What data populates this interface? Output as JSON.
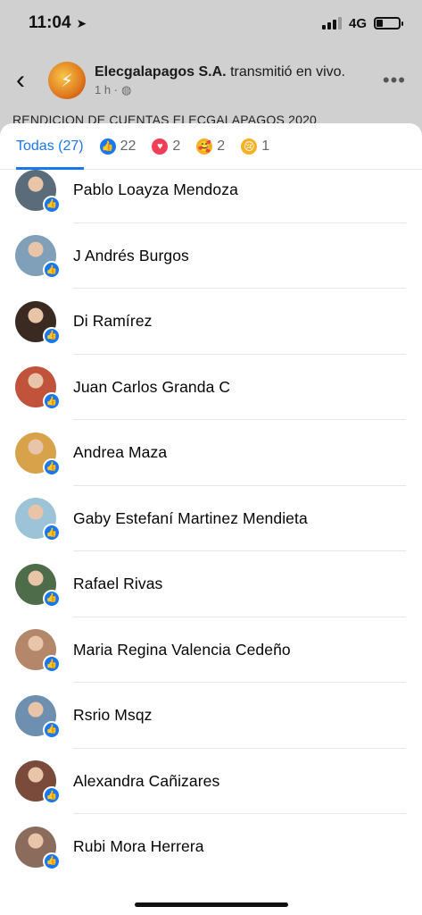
{
  "status_bar": {
    "time": "11:04",
    "network": "4G",
    "battery_level": 0.3
  },
  "post": {
    "page_name": "Elecgalapagos S.A.",
    "action_text": "transmitió en vivo.",
    "time_ago": "1 h ·",
    "text_preview": "RENDICION DE CUENTAS ELECGALAPAGOS 2020"
  },
  "tabs": [
    {
      "label": "Todas (27)",
      "icon": "none"
    },
    {
      "label": "22",
      "icon": "like-icon"
    },
    {
      "label": "2",
      "icon": "love-icon"
    },
    {
      "label": "2",
      "icon": "care-icon"
    },
    {
      "label": "1",
      "icon": "sad-icon"
    }
  ],
  "people": [
    {
      "name": "Pablo Loayza Mendoza",
      "avatar_color": "#5a6b7a"
    },
    {
      "name": "J Andrés Burgos",
      "avatar_color": "#7fa0b8"
    },
    {
      "name": "Di Ramírez",
      "avatar_color": "#3b2a22"
    },
    {
      "name": "Juan Carlos Granda C",
      "avatar_color": "#c0533a"
    },
    {
      "name": "Andrea Maza",
      "avatar_color": "#d8a24a"
    },
    {
      "name": "Gaby Estefaní Martinez Mendieta",
      "avatar_color": "#9cc3d8"
    },
    {
      "name": "Rafael Rivas",
      "avatar_color": "#4e6b4a"
    },
    {
      "name": "Maria Regina Valencia Cedeño",
      "avatar_color": "#b5876a"
    },
    {
      "name": "Rsrio Msqz",
      "avatar_color": "#6f8fb0"
    },
    {
      "name": "Alexandra Cañizares",
      "avatar_color": "#7a4a3a"
    },
    {
      "name": "Rubi Mora Herrera",
      "avatar_color": "#8a6b5c"
    }
  ]
}
